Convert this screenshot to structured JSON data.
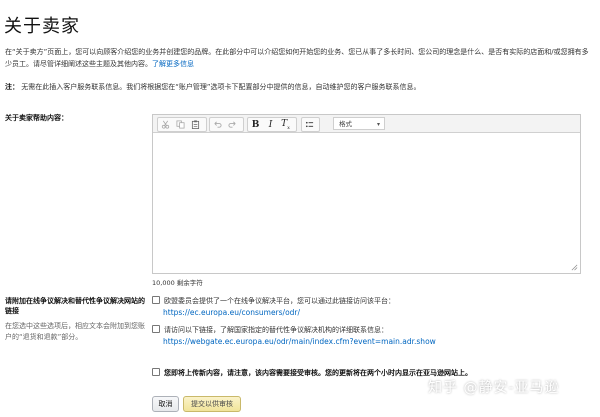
{
  "breadcrumb": "",
  "page_title": "关于卖家",
  "intro": {
    "text": "在“关于卖方”页面上，您可以向顾客介绍您的业务并创建您的品牌。在此部分中可以介绍您如何开始您的业务、您已从事了多长时间、您公司的理念是什么、是否有实际的店面和/或您拥有多少员工。请尽管详细阐述这些主题及其他内容。",
    "link": "了解更多信息"
  },
  "note": {
    "label": "注：",
    "text": "无需在此插入客户服务联系信息。我们将根据您在“账户管理”选项卡下配置部分中提供的信息，自动维护您的客户服务联系信息。"
  },
  "editor": {
    "label": "关于卖家帮助内容：",
    "format_select": "格式",
    "char_count": "10,000 剩余字符",
    "toolbar_icons": [
      "cut-icon",
      "copy-icon",
      "paste-icon",
      "undo-icon",
      "redo-icon",
      "bold-icon",
      "italic-icon",
      "remove-format-icon",
      "bulleted-list-icon"
    ]
  },
  "dispute": {
    "label": "请附加在线争议解决和替代性争议解决网站的链接",
    "description": "在您选中这些选项后，相应文本会附加到您账户的“退货和退款”部分。",
    "options": [
      {
        "label": "欧盟委员会提供了一个在线争议解决平台，您可以通过此链接访问该平台：",
        "url": "https://ec.europa.eu/consumers/odr/",
        "checked": false
      },
      {
        "label": "请访问以下链接，了解国家指定的替代性争议解决机构的详细联系信息：",
        "url": "https://webgate.ec.europa.eu/odr/main/index.cfm?event=main.adr.show",
        "checked": false
      }
    ]
  },
  "acknowledge": {
    "label": "您即将上传新内容，请注意，该内容需要接受审核。您的更新将在两个小时内显示在亚马逊网站上。",
    "checked": false
  },
  "actions": {
    "cancel": "取消",
    "submit": "提交以供审核"
  },
  "watermark": "知乎 @静安-亚马逊",
  "colors": {
    "link": "#0066c0",
    "submit_bg": "#f1e49a",
    "toolbar_bg": "#f3f3f3"
  }
}
